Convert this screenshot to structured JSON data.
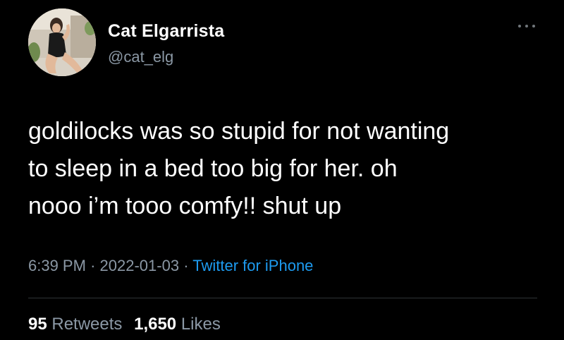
{
  "author": {
    "display_name": "Cat Elgarrista",
    "handle": "@cat_elg",
    "avatar_icon": "profile-photo-avatar"
  },
  "menu": {
    "icon": "more-options-icon"
  },
  "tweet": {
    "text": "goldilocks was so stupid for not wanting\nto sleep in a bed too big for her. oh\nnooo i’m tooo comfy!! shut up"
  },
  "meta": {
    "time": "6:39 PM",
    "separator": "·",
    "date": "2022-01-03",
    "source": "Twitter for iPhone"
  },
  "stats": {
    "retweets_count": "95",
    "retweets_label": "Retweets",
    "likes_count": "1,650",
    "likes_label": "Likes"
  },
  "colors": {
    "background": "#000000",
    "text": "#ffffff",
    "secondary_text": "#8b98a5",
    "link": "#1d9bf0",
    "divider": "#2f3336"
  }
}
